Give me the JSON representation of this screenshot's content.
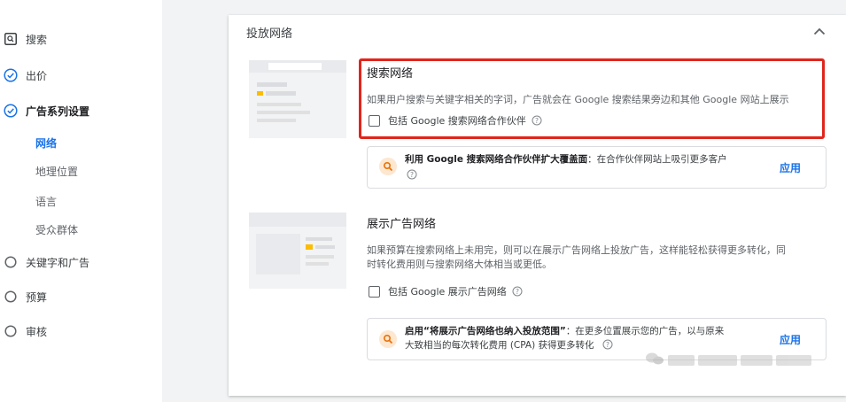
{
  "sidebar": {
    "items": [
      {
        "label": "搜索",
        "icon": "search-box-icon"
      },
      {
        "label": "出价",
        "icon": "check-circle-icon"
      },
      {
        "label": "广告系列设置",
        "icon": "check-circle-icon"
      },
      {
        "label": "关键字和广告",
        "icon": "radio-empty-icon"
      },
      {
        "label": "预算",
        "icon": "radio-empty-icon"
      },
      {
        "label": "审核",
        "icon": "radio-empty-icon"
      }
    ],
    "sub_items": [
      {
        "label": "网络",
        "active": true
      },
      {
        "label": "地理位置"
      },
      {
        "label": "语言"
      },
      {
        "label": "受众群体"
      }
    ]
  },
  "card": {
    "title": "投放网络",
    "collapse_icon": "chevron-up-icon",
    "search_network": {
      "title": "搜索网络",
      "description": "如果用户搜索与关键字相关的字词，广告就会在 Google 搜索结果旁边和其他 Google 网站上展示",
      "checkbox_label": "包括 Google 搜索网络合作伙伴",
      "checked": false
    },
    "search_recommendation": {
      "bold": "利用 Google 搜索网络合作伙伴扩大覆盖面",
      "text": "：在合作伙伴网站上吸引更多客户",
      "apply_label": "应用",
      "icon": "search-icon"
    },
    "display_network": {
      "title": "展示广告网络",
      "description_line1": "如果预算在搜索网络上未用完，则可以在展示广告网络上投放广告，这样能轻松获得更多转化，同",
      "description_line2": "时转化费用则与搜索网络大体相当或更低。",
      "checkbox_label": "包括 Google 展示广告网络",
      "checked": false
    },
    "display_recommendation": {
      "bold": "启用“将展示广告网络也纳入投放范围”",
      "text_line1": "：在更多位置展示您的广告，以与原来",
      "text_line2": "大致相当的每次转化费用 (CPA) 获得更多转化",
      "apply_label": "应用",
      "icon": "search-icon"
    }
  },
  "colors": {
    "accent": "#1a73e8",
    "highlight_border": "#e0251b",
    "rec_icon_bg": "#fde7d0",
    "rec_icon_fg": "#e8710a"
  }
}
